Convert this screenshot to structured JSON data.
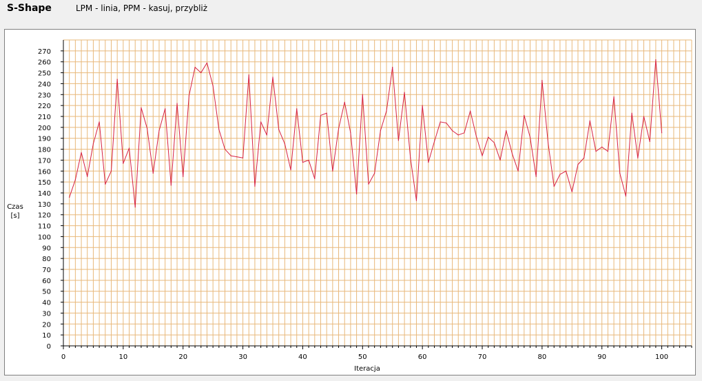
{
  "header": {
    "title": "S-Shape",
    "hint": "LPM - linia, PPM - kasuj, przybliż"
  },
  "colors": {
    "background": "#f0f0f0",
    "plot_background": "#ffffff",
    "grid": "#e8b87a",
    "series": "#d62040",
    "axis": "#000000"
  },
  "chart_data": {
    "type": "line",
    "xlabel": "Iteracja",
    "ylabel_lines": [
      "Czas",
      "[s]"
    ],
    "xlim": [
      0,
      105
    ],
    "ylim": [
      0,
      280
    ],
    "x_ticks": [
      0,
      10,
      20,
      30,
      40,
      50,
      60,
      70,
      80,
      90,
      100
    ],
    "y_ticks": [
      0,
      10,
      20,
      30,
      40,
      50,
      60,
      70,
      80,
      90,
      100,
      110,
      120,
      130,
      140,
      150,
      160,
      170,
      180,
      190,
      200,
      210,
      220,
      230,
      240,
      250,
      260,
      270
    ],
    "grid": true,
    "grid_x_step": 1,
    "grid_y_step": 10,
    "legend": "none",
    "series": [
      {
        "x": [
          1,
          2,
          3,
          4,
          5,
          6,
          7,
          8,
          9,
          10,
          11,
          12,
          13,
          14,
          15,
          16,
          17,
          18,
          19,
          20,
          21,
          22,
          23,
          24,
          25,
          26,
          27,
          28,
          29,
          30,
          31,
          32,
          33,
          34,
          35,
          36,
          37,
          38,
          39,
          40,
          41,
          42,
          43,
          44,
          45,
          46,
          47,
          48,
          49,
          50,
          51,
          52,
          53,
          54,
          55,
          56,
          57,
          58,
          59,
          60,
          61,
          62,
          63,
          64,
          65,
          66,
          67,
          68,
          69,
          70,
          71,
          72,
          73,
          74,
          75,
          76,
          77,
          78,
          79,
          80,
          81,
          82,
          83,
          84,
          85,
          86,
          87,
          88,
          89,
          90,
          91,
          92,
          93,
          94,
          95,
          96,
          97,
          98,
          99,
          100
        ],
        "y": [
          136,
          152,
          177,
          155,
          185,
          205,
          148,
          160,
          244,
          167,
          181,
          127,
          218,
          199,
          158,
          197,
          217,
          147,
          222,
          155,
          229,
          255,
          250,
          259,
          238,
          198,
          180,
          174,
          173,
          172,
          248,
          146,
          205,
          193,
          246,
          198,
          185,
          161,
          217,
          168,
          170,
          153,
          211,
          213,
          160,
          199,
          223,
          195,
          139,
          230,
          148,
          158,
          197,
          215,
          255,
          188,
          232,
          172,
          133,
          220,
          168,
          187,
          205,
          204,
          197,
          193,
          195,
          215,
          192,
          174,
          191,
          186,
          170,
          197,
          176,
          160,
          211,
          191,
          155,
          243,
          186,
          146,
          157,
          160,
          141,
          166,
          172,
          206,
          178,
          182,
          178,
          228,
          158,
          137,
          213,
          172,
          210,
          187,
          262,
          195
        ]
      }
    ]
  }
}
